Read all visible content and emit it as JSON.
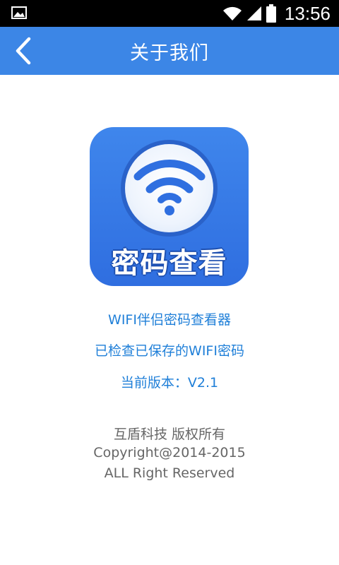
{
  "status_bar": {
    "time": "13:56",
    "icons": [
      "gallery-icon",
      "wifi-icon",
      "signal-icon",
      "battery-icon"
    ]
  },
  "app_bar": {
    "title": "关于我们",
    "back_icon": "chevron-left-icon",
    "background_color": "#3c86e6"
  },
  "app_icon": {
    "label": "密码查看",
    "symbol": "wifi-icon"
  },
  "info": {
    "app_name": "WIFI伴侣密码查看器",
    "description": "已检查已保存的WIFI密码",
    "version": "当前版本：V2.1"
  },
  "footer": {
    "company": "互盾科技  版权所有",
    "copyright": "Copyright@2014-2015",
    "rights": "ALL Right Reserved"
  },
  "colors": {
    "accent": "#3c86e6",
    "info_text": "#1f7fd8",
    "footer_text": "#666666"
  }
}
